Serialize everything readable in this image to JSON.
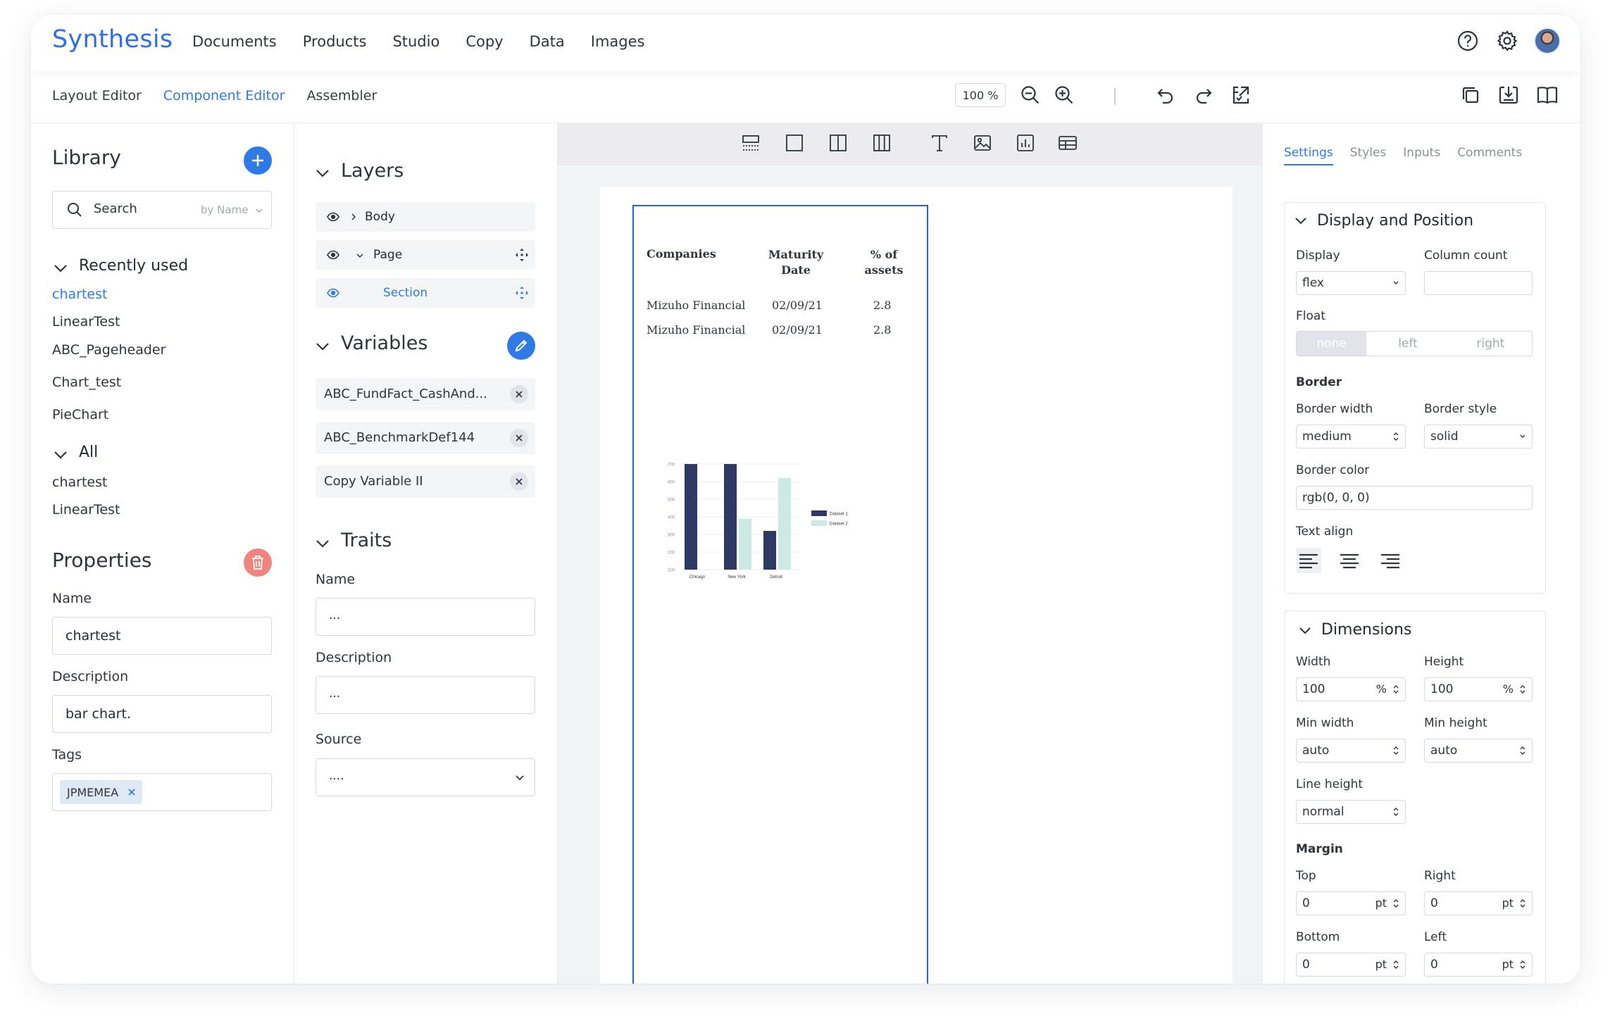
{
  "app": {
    "logo": "Synthesis"
  },
  "topnav": [
    "Documents",
    "Products",
    "Studio",
    "Copy",
    "Data",
    "Images"
  ],
  "subtabs": [
    {
      "label": "Layout Editor",
      "active": false
    },
    {
      "label": "Component Editor",
      "active": true
    },
    {
      "label": "Assembler",
      "active": false
    }
  ],
  "toolbar": {
    "zoom": "100 %"
  },
  "library": {
    "title": "Library",
    "search_placeholder": "Search",
    "search_by": "by Name",
    "recent_heading": "Recently used",
    "recent": [
      "chartest",
      "LinearTest",
      "ABC_Pageheader",
      "Chart_test",
      "PieChart"
    ],
    "all_heading": "All",
    "all": [
      "chartest",
      "LinearTest"
    ]
  },
  "properties": {
    "title": "Properties",
    "name_label": "Name",
    "name_value": "chartest",
    "description_label": "Description",
    "description_value": "bar chart.",
    "tags_label": "Tags",
    "tags": [
      "JPMEMEA"
    ]
  },
  "layers": {
    "title": "Layers",
    "items": [
      {
        "label": "Body"
      },
      {
        "label": "Page"
      },
      {
        "label": "Section"
      }
    ]
  },
  "variables": {
    "title": "Variables",
    "items": [
      "ABC_FundFact_CashAnd...",
      "ABC_BenchmarkDef144",
      "Copy Variable II"
    ]
  },
  "traits": {
    "title": "Traits",
    "name_label": "Name",
    "name_value": "...",
    "description_label": "Description",
    "description_value": "...",
    "source_label": "Source",
    "source_value": "...."
  },
  "table": {
    "headers": [
      "Companies",
      "Maturity Date",
      "% of assets"
    ],
    "rows": [
      [
        "Mizuho Financial",
        "02/09/21",
        "2.8"
      ],
      [
        "Mizuho Financial",
        "02/09/21",
        "2.8"
      ]
    ]
  },
  "chart_data": {
    "type": "bar",
    "categories": [
      "Chicago",
      "New York",
      "Detroit"
    ],
    "series": [
      {
        "name": "Dataset 1",
        "values": [
          700,
          700,
          320
        ]
      },
      {
        "name": "Dataset 2",
        "values": [
          null,
          390,
          620
        ]
      }
    ],
    "yticks": [
      "700",
      "600",
      "500",
      "400",
      "300",
      "200",
      "100"
    ],
    "ylim": [
      100,
      700
    ],
    "legend_position": "right",
    "colors": [
      "#2f3a64",
      "#cde9e4"
    ]
  },
  "settings": {
    "tabs": [
      {
        "label": "Settings",
        "active": true
      },
      {
        "label": "Styles",
        "active": false
      },
      {
        "label": "Inputs",
        "active": false
      },
      {
        "label": "Comments",
        "active": false
      }
    ],
    "display_section": {
      "title": "Display and Position",
      "display_label": "Display",
      "display_value": "flex",
      "column_count_label": "Column count",
      "float_label": "Float",
      "float_options": [
        "none",
        "left",
        "right"
      ],
      "border_heading": "Border",
      "border_width_label": "Border width",
      "border_width_value": "medium",
      "border_style_label": "Border style",
      "border_style_value": "solid",
      "border_color_label": "Border color",
      "border_color_value": "rgb(0, 0, 0)",
      "text_align_label": "Text align"
    },
    "dimensions": {
      "title": "Dimensions",
      "width_label": "Width",
      "width_value": "100",
      "width_unit": "%",
      "height_label": "Height",
      "height_value": "100",
      "height_unit": "%",
      "min_width_label": "Min width",
      "min_width_value": "auto",
      "min_height_label": "Min height",
      "min_height_value": "auto",
      "line_height_label": "Line height",
      "line_height_value": "normal",
      "margin_heading": "Margin",
      "top_label": "Top",
      "top_value": "0",
      "top_unit": "pt",
      "right_label": "Right",
      "right_value": "0",
      "right_unit": "pt",
      "bottom_label": "Bottom",
      "bottom_value": "0",
      "bottom_unit": "pt",
      "left_label": "Left",
      "left_value": "0",
      "left_unit": "pt"
    }
  }
}
